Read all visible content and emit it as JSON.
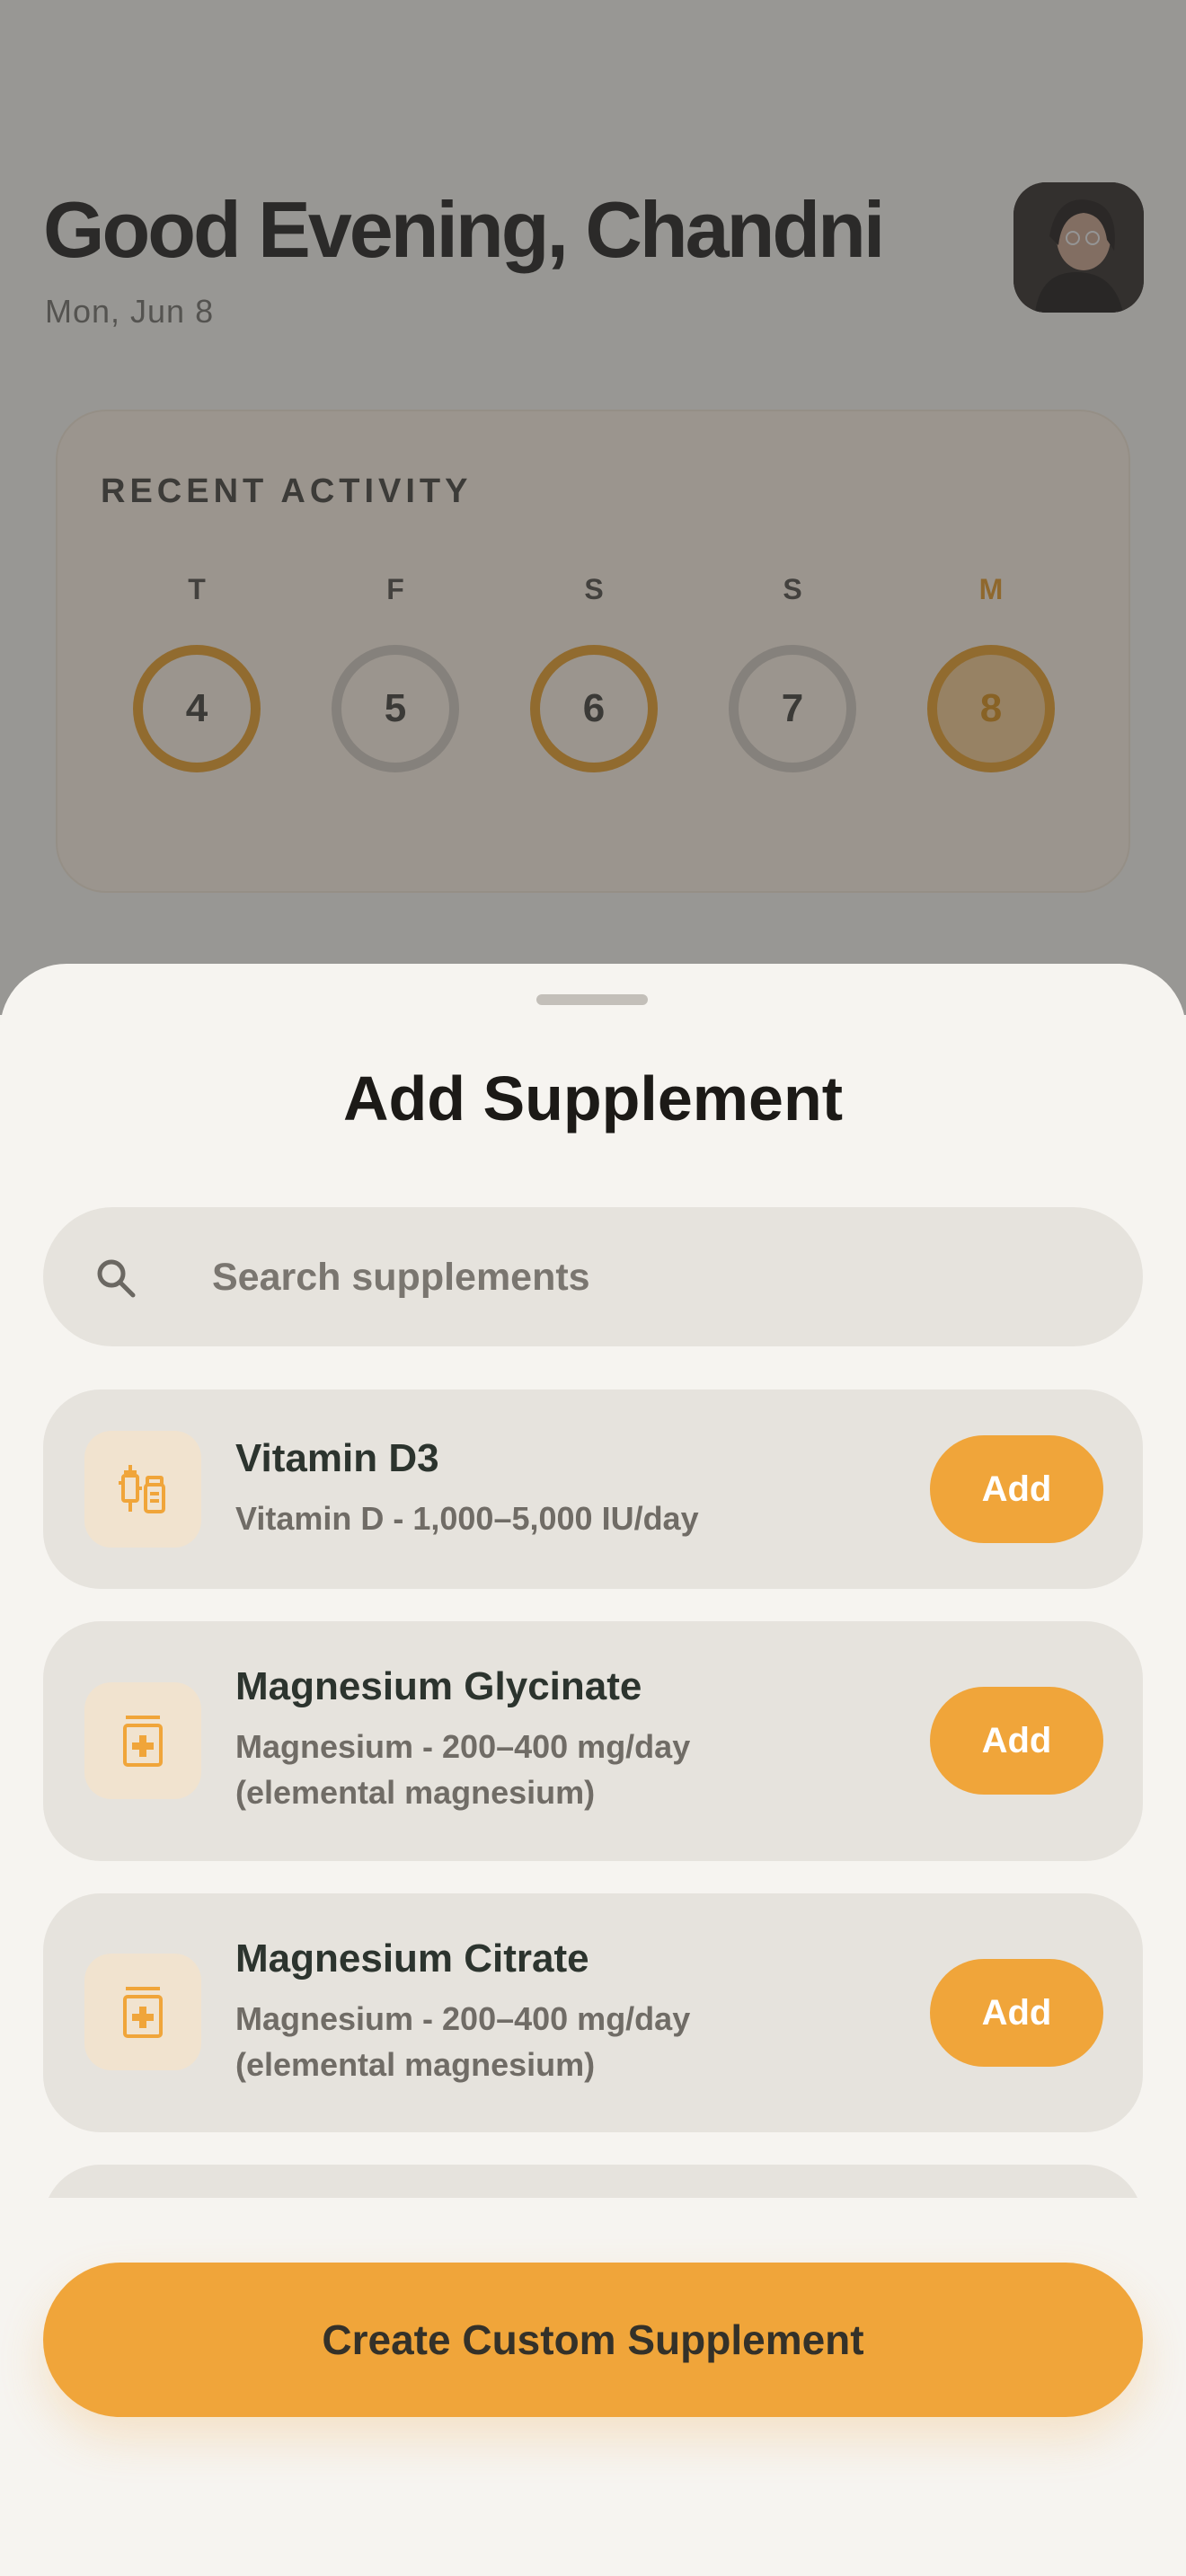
{
  "header": {
    "greeting": "Good Evening, Chandni",
    "date": "Mon, Jun 8"
  },
  "recent_activity": {
    "title": "RECENT ACTIVITY",
    "days": [
      {
        "letter": "T",
        "number": "4",
        "state": "done"
      },
      {
        "letter": "F",
        "number": "5",
        "state": "empty"
      },
      {
        "letter": "S",
        "number": "6",
        "state": "done"
      },
      {
        "letter": "S",
        "number": "7",
        "state": "empty"
      },
      {
        "letter": "M",
        "number": "8",
        "state": "today"
      }
    ]
  },
  "sheet": {
    "title": "Add Supplement",
    "search_placeholder": "Search supplements",
    "items": [
      {
        "name": "Vitamin D3",
        "description": "Vitamin D - 1,000–5,000 IU/day",
        "icon": "syringe-vial-icon",
        "action": "Add"
      },
      {
        "name": "Magnesium Glycinate",
        "description": "Magnesium - 200–400 mg/day (elemental magnesium)",
        "icon": "pill-bottle-icon",
        "action": "Add"
      },
      {
        "name": "Magnesium Citrate",
        "description": "Magnesium - 200–400 mg/day (elemental magnesium)",
        "icon": "pill-bottle-icon",
        "action": "Add"
      }
    ],
    "create_button": "Create Custom Supplement"
  },
  "colors": {
    "accent": "#f0a53a",
    "sheet_background": "#f6f4f0",
    "card_background": "#e6e3dd"
  }
}
